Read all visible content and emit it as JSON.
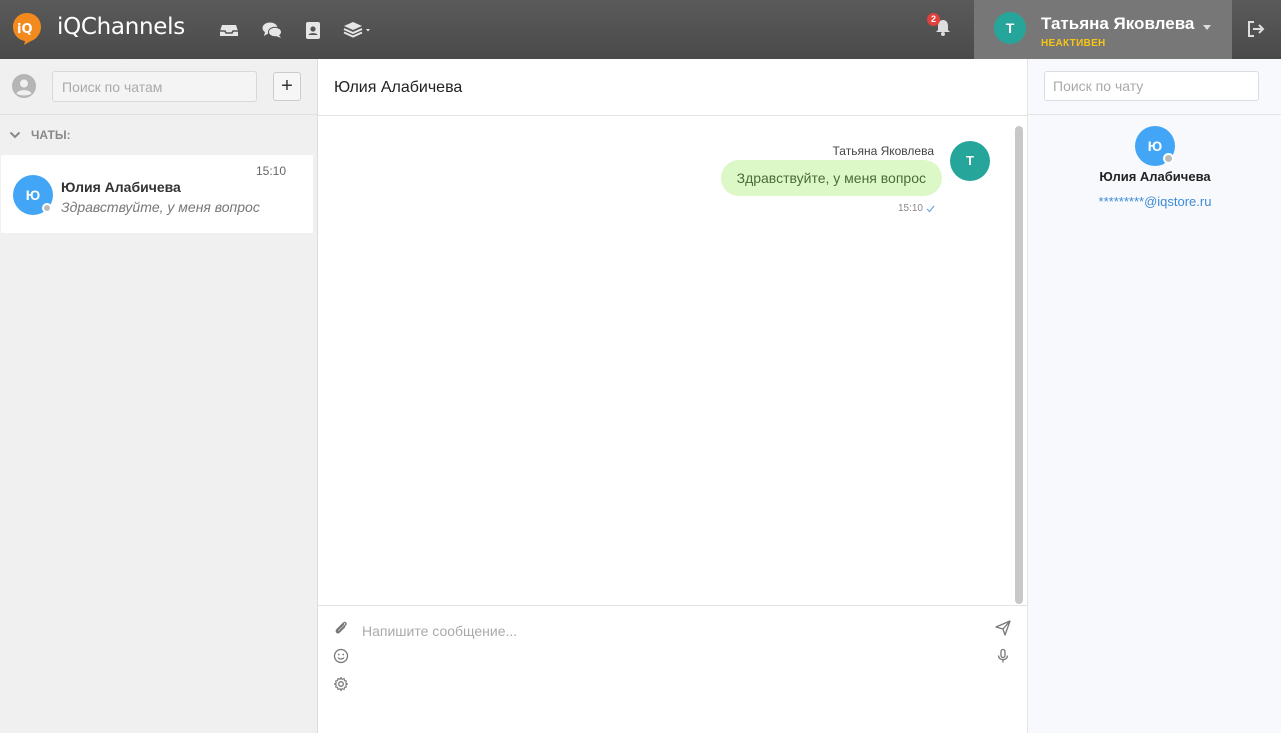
{
  "app": {
    "brand": "iQChannels",
    "notifications_count": "2",
    "colors": {
      "accent": "#26a69a",
      "client": "#42a5f5",
      "status": "#f5c518",
      "bubble": "#dcf8c6"
    }
  },
  "user": {
    "initial": "Т",
    "name": "Татьяна Яковлева",
    "status": "НЕАКТИВЕН"
  },
  "left": {
    "search_placeholder": "Поиск по чатам",
    "add_label": "+",
    "section_label": "ЧАТЫ:",
    "chats": [
      {
        "initial": "Ю",
        "name": "Юлия Алабичева",
        "time": "15:10",
        "last_message": "Здравствуйте, у меня вопрос"
      }
    ]
  },
  "conversation": {
    "title": "Юлия Алабичева",
    "messages": [
      {
        "author": "Татьяна Яковлева",
        "author_initial": "Т",
        "text": "Здравствуйте, у меня вопрос",
        "time": "15:10"
      }
    ],
    "composer_placeholder": "Напишите сообщение..."
  },
  "right": {
    "search_placeholder": "Поиск по чату",
    "client": {
      "initial": "Ю",
      "name": "Юлия Алабичева",
      "email": "*********@iqstore.ru"
    }
  }
}
